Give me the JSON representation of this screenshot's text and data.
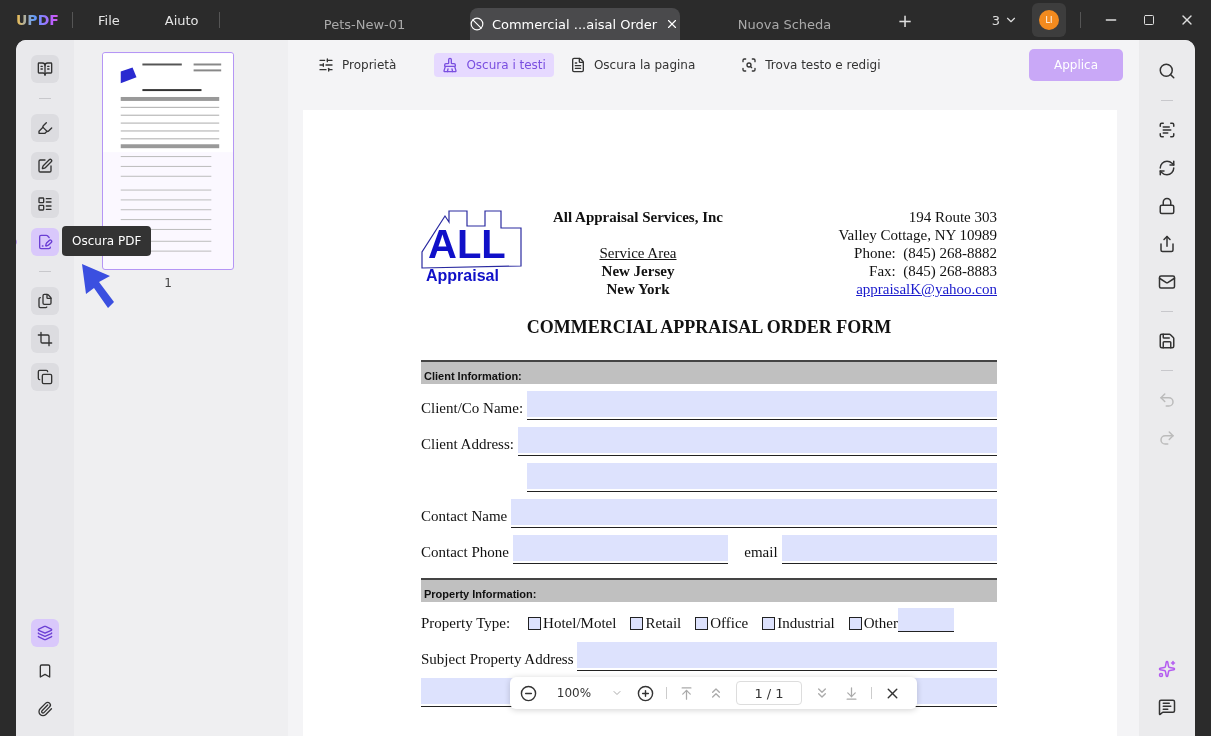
{
  "app": {
    "logo": "UPDF",
    "menu": [
      "File",
      "Aiuto"
    ]
  },
  "tabs": [
    {
      "label": "Pets-New-01",
      "selected": false
    },
    {
      "label": "Commercial ...aisal Order",
      "selected": true
    },
    {
      "label": "Nuova Scheda",
      "selected": false
    }
  ],
  "new_tab": "+",
  "window_count": "3",
  "avatar": "LI",
  "left_tools": [
    {
      "selected": false
    },
    {
      "selected": false
    },
    {
      "selected": false
    },
    {
      "selected": false
    },
    {
      "selected": true
    },
    {
      "selected": false
    },
    {
      "selected": false
    },
    {
      "selected": false
    }
  ],
  "bottom_tools": [
    {
      "selected": true
    },
    {
      "selected": false
    },
    {
      "selected": false
    }
  ],
  "tooltip": "Oscura PDF",
  "thumbnails": [
    {
      "page": "1",
      "selected": true
    }
  ],
  "redact_toolbar": {
    "items": [
      {
        "label": "Proprietà",
        "selected": false
      },
      {
        "label": "Oscura i testi",
        "selected": true
      },
      {
        "label": "Oscura la pagina",
        "selected": false
      },
      {
        "label": "Trova testo e redigi",
        "selected": false
      }
    ],
    "apply": {
      "label": "Applica",
      "disabled": true
    }
  },
  "document": {
    "logo": {
      "big": "ALL",
      "small": "Appraisal"
    },
    "company": "All Appraisal Services, Inc",
    "service_area_title": "Service Area",
    "service_areas": [
      "New Jersey",
      "New York"
    ],
    "address": [
      "194 Route 303",
      "Valley Cottage, NY 10989",
      "Phone:  (845) 268-8882",
      "Fax:  (845) 268-8883"
    ],
    "email": "appraisalK@yahoo.con",
    "title": "COMMERCIAL APPRAISAL ORDER FORM",
    "sections": [
      {
        "heading": "Client Information:",
        "rows": [
          {
            "kind": "field",
            "label": "Client/Co Name:"
          },
          {
            "kind": "field",
            "label": "Client Address:"
          },
          {
            "kind": "continuation"
          },
          {
            "kind": "field",
            "label": "Contact Name"
          },
          {
            "kind": "pair",
            "label": "Contact Phone",
            "label2": "email"
          }
        ]
      },
      {
        "heading": "Property Information:",
        "rows": [
          {
            "kind": "checks",
            "label": "Property Type:",
            "options": [
              {
                "label": "Hotel/Motel",
                "checked": false
              },
              {
                "label": "Retail",
                "checked": false
              },
              {
                "label": "Office",
                "checked": false
              },
              {
                "label": "Industrial",
                "checked": false
              },
              {
                "label": "Other",
                "checked": false
              }
            ]
          },
          {
            "kind": "field",
            "label": "Subject Property Address"
          },
          {
            "kind": "pair"
          }
        ]
      }
    ]
  },
  "zoom_bar": {
    "zoom": "100%",
    "page_indicator": "1 / 1"
  },
  "right_tools": [
    {
      "disabled": false
    },
    {
      "disabled": false
    },
    {
      "disabled": false
    },
    {
      "disabled": false
    },
    {
      "disabled": false
    },
    {
      "disabled": false
    },
    {
      "disabled": false
    },
    {
      "disabled": true
    },
    {
      "disabled": true
    }
  ]
}
